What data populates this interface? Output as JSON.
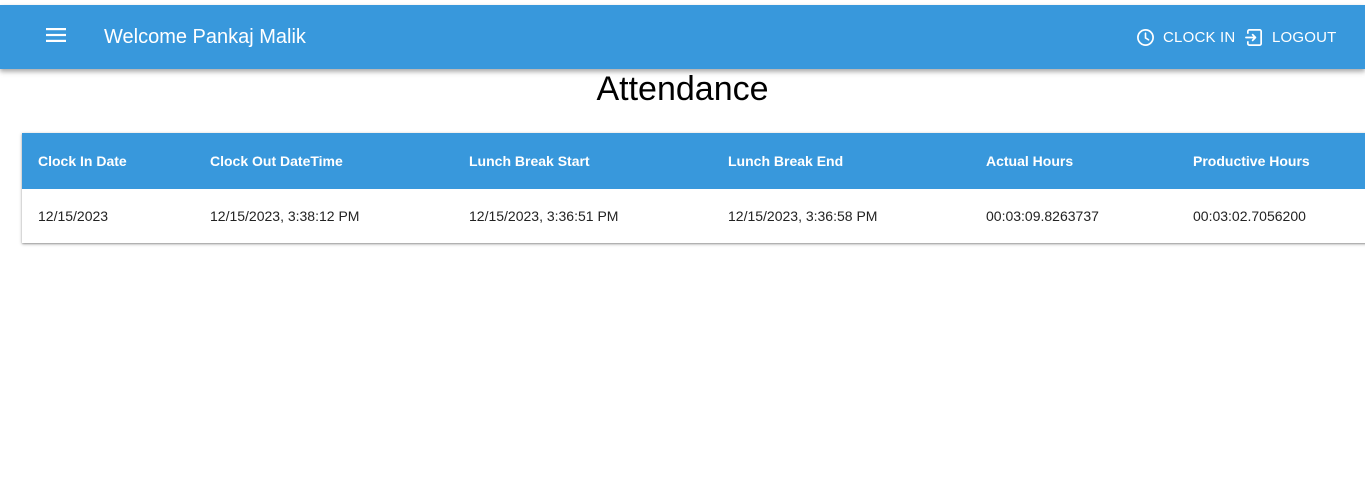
{
  "appbar": {
    "menu_icon": "menu-icon",
    "title": "Welcome Pankaj Malik",
    "clock_in_icon": "clock-icon",
    "clock_in_label": "CLOCK IN",
    "logout_icon": "logout-icon",
    "logout_label": "LOGOUT",
    "color": "#3898dc"
  },
  "page": {
    "title": "Attendance"
  },
  "table": {
    "columns": [
      "Clock In Date",
      "Clock Out DateTime",
      "Lunch Break Start",
      "Lunch Break End",
      "Actual Hours",
      "Productive Hours"
    ],
    "rows": [
      [
        "12/15/2023",
        "12/15/2023, 3:38:12 PM",
        "12/15/2023, 3:36:51 PM",
        "12/15/2023, 3:36:58 PM",
        "00:03:09.8263737",
        "00:03:02.7056200"
      ]
    ]
  }
}
